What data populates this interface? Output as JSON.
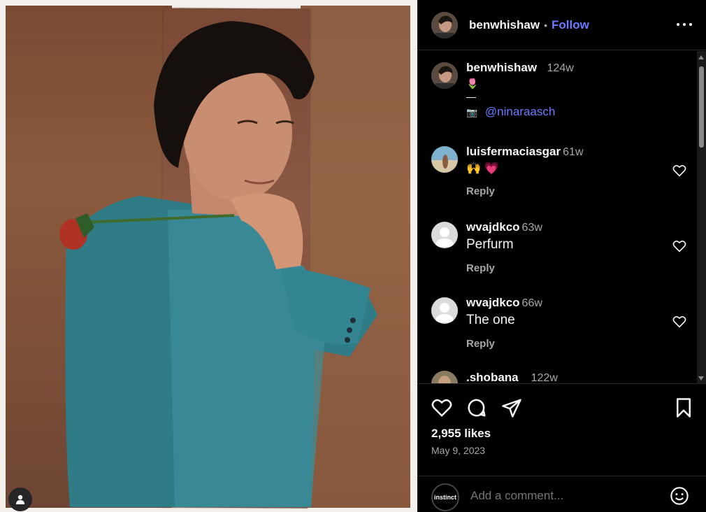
{
  "post": {
    "username": "benwhishaw",
    "follow_label": "Follow",
    "caption_time": "124w",
    "caption_emoji": "🌷",
    "caption_dash": "—",
    "caption_camera": "📷",
    "caption_mention": "@ninaraasch"
  },
  "comments": [
    {
      "user": "luisfermaciasgar",
      "time": "61w",
      "text": "🙌 💗",
      "reply": "Reply"
    },
    {
      "user": "wvajdkco",
      "time": "63w",
      "text": "Perfurm",
      "reply": "Reply"
    },
    {
      "user": "wvajdkco",
      "time": "66w",
      "text": "The one",
      "reply": "Reply"
    },
    {
      "user": ".shobana",
      "time": "122w"
    }
  ],
  "stats": {
    "likes": "2,955 likes",
    "date": "May 9, 2023"
  },
  "composer": {
    "avatar_label": "instinct",
    "placeholder": "Add a comment..."
  },
  "colors": {
    "link": "#6a7bff",
    "background": "#000000",
    "secondary_text": "#a8a8a8"
  }
}
